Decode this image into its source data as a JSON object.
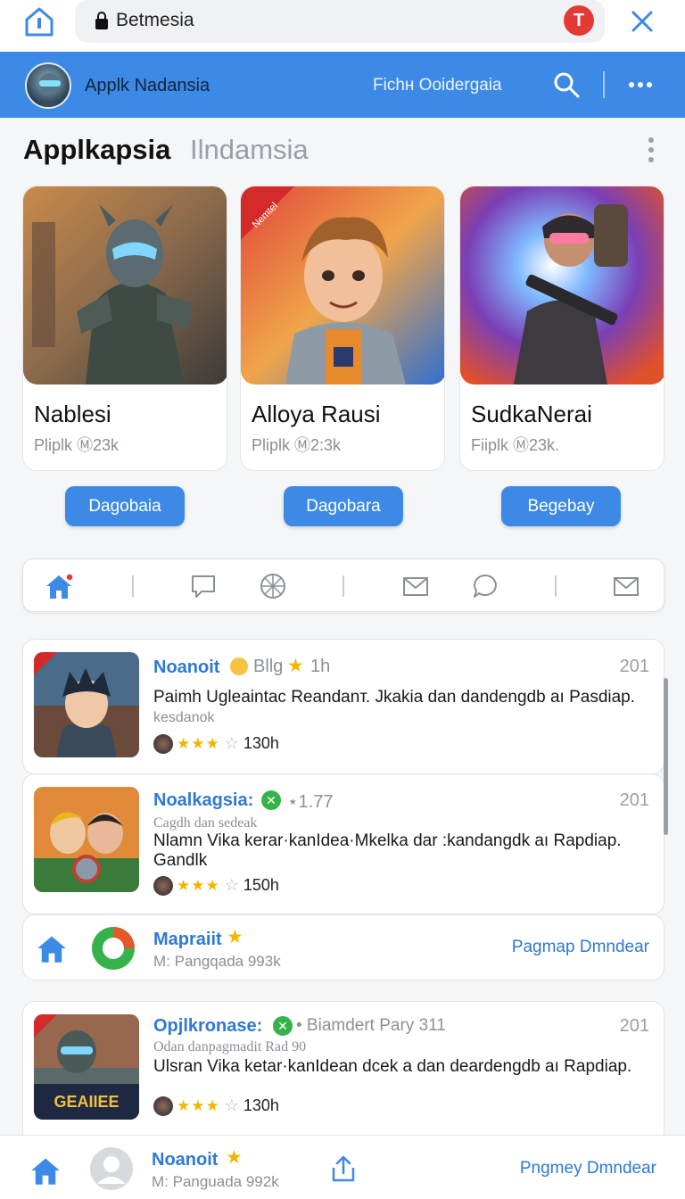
{
  "browser": {
    "url": "Betmesia",
    "extension_letter": "T"
  },
  "appbar": {
    "title": "Applk Nadansia",
    "link": "Fichн Ooidergaia"
  },
  "section": {
    "title": "Applkapsia",
    "subtitle": "Ilndamsia"
  },
  "cards": [
    {
      "name": "Nablesi",
      "meta": "Pliplk Ⓜ23k",
      "button": "Dagobaia"
    },
    {
      "name": "Alloya Rausi",
      "meta": "Pliplk Ⓜ2:3k",
      "button": "Dagobara",
      "ribbon": "Nemtel"
    },
    {
      "name": "SudkaNerai",
      "meta": "Fiiplk Ⓜ23k.",
      "button": "Begebay"
    }
  ],
  "feed": [
    {
      "title": "Noanoit",
      "tag": "Bllg",
      "time": "1h",
      "num": "201",
      "line": "Paimh Ugleaintac Reandanт. Jkakia dan dandengdb aı Pasdiap.",
      "small": "kesdanok",
      "rating": "130h"
    },
    {
      "title": "Noalkagsia:",
      "tag": "⋆1.77",
      "num": "201",
      "small": "Cagdh dan sedeak",
      "line": "Nlamn Vika kerar·kanIdea·Mkelka dar :kandangdk aı Rapdiap.",
      "line2": "Gandlk",
      "rating": "150h"
    },
    {
      "title": "Mapraiit",
      "small": "M: Pangqada 993k",
      "link": "Pagmap Dmndear"
    },
    {
      "title": "Opjlkronase:",
      "tag": "• Biamdert Pary 311",
      "num": "201",
      "small": "Odan danpagmadit Rad 90",
      "line": "Ulsran Vika ketar·kanIdean dcek a dan deardengdb aı Rapdiap.",
      "thumb_text": "GEAIIEE",
      "rating": "130h"
    }
  ],
  "bottom": {
    "title": "Noanoit",
    "small": "M: Panguada 992k",
    "link": "Pngmey Dmndear"
  },
  "colors": {
    "accent": "#3d8ae6",
    "link": "#2f78d6",
    "star": "#f2b600",
    "badge_green": "#35b34a"
  }
}
